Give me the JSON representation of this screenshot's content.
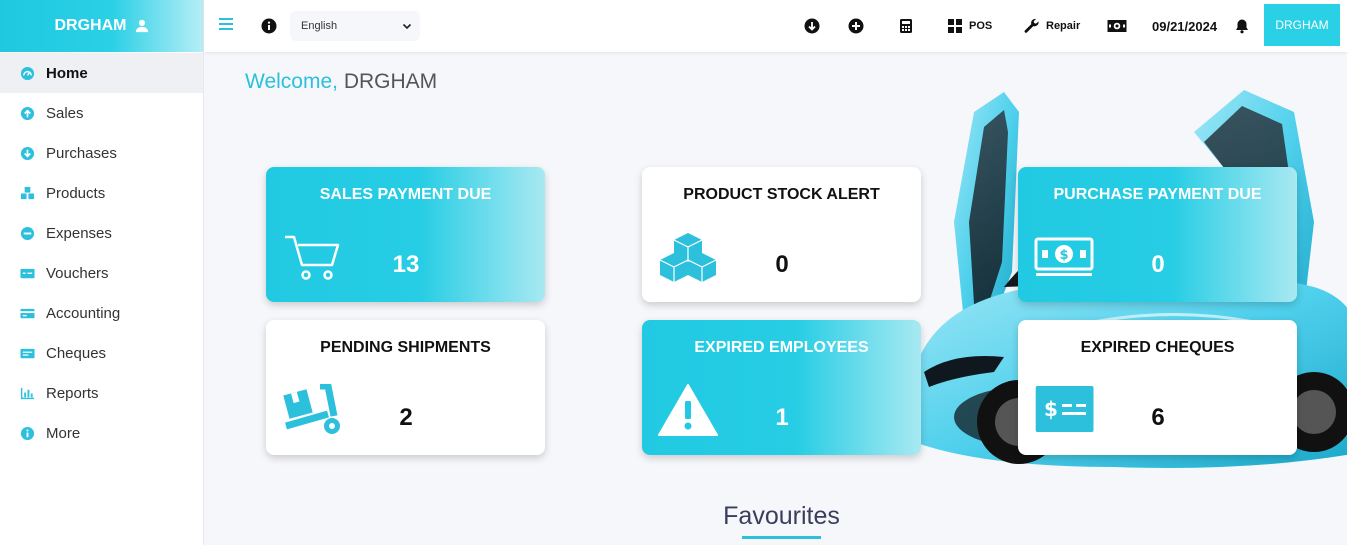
{
  "sidebar": {
    "brand": "DRGHAM",
    "items": [
      {
        "label": "Home",
        "icon": "dashboard-icon",
        "active": true
      },
      {
        "label": "Sales",
        "icon": "arrow-up-circle-icon"
      },
      {
        "label": "Purchases",
        "icon": "arrow-down-circle-icon"
      },
      {
        "label": "Products",
        "icon": "cubes-icon"
      },
      {
        "label": "Expenses",
        "icon": "minus-circle-icon"
      },
      {
        "label": "Vouchers",
        "icon": "voucher-icon"
      },
      {
        "label": "Accounting",
        "icon": "card-icon"
      },
      {
        "label": "Cheques",
        "icon": "cheque-icon"
      },
      {
        "label": "Reports",
        "icon": "bar-chart-icon"
      },
      {
        "label": "More",
        "icon": "info-circle-icon"
      }
    ]
  },
  "topbar": {
    "language": "English",
    "pos_label": "POS",
    "repair_label": "Repair",
    "date": "09/21/2024",
    "user": "DRGHAM"
  },
  "main": {
    "welcome_prefix": "Welcome,",
    "welcome_name": "DRGHAM",
    "cards": [
      {
        "title": "SALES PAYMENT DUE",
        "value": "13",
        "icon": "cart-icon"
      },
      {
        "title": "PRODUCT STOCK ALERT",
        "value": "0",
        "icon": "cubes-icon"
      },
      {
        "title": "PURCHASE PAYMENT DUE",
        "value": "0",
        "icon": "money-bill-icon"
      },
      {
        "title": "PENDING SHIPMENTS",
        "value": "2",
        "icon": "dolly-icon"
      },
      {
        "title": "EXPIRED EMPLOYEES",
        "value": "1",
        "icon": "warning-icon"
      },
      {
        "title": "EXPIRED CHEQUES",
        "value": "6",
        "icon": "cheque-icon"
      }
    ],
    "favourites_title": "Favourites"
  },
  "colors": {
    "accent": "#2ad0e6",
    "accent_text": "#2cc0dc",
    "card_white": "#ffffff"
  }
}
